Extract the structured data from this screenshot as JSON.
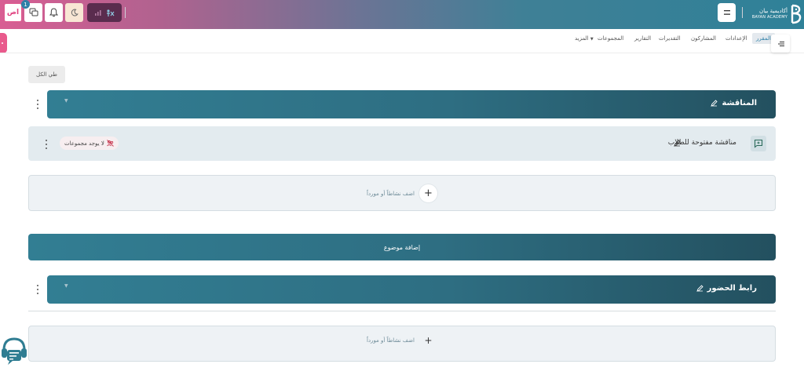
{
  "header": {
    "lang_label": "اص",
    "message_count": "1",
    "brand_name_ar": "أكاديمية بيان",
    "brand_name_en": "BAYAN ACADEMY"
  },
  "nav": {
    "tabs": [
      {
        "label": "المقرر",
        "active": true
      },
      {
        "label": "الإعدادات",
        "active": false
      },
      {
        "label": "المشاركون",
        "active": false
      },
      {
        "label": "التقديرات",
        "active": false
      },
      {
        "label": "التقارير",
        "active": false
      },
      {
        "label": "المجموعات",
        "active": false
      },
      {
        "label": "المزيد",
        "active": false
      }
    ]
  },
  "content": {
    "collapse_all_label": "طي الكل",
    "sections": [
      {
        "title": "المناقشة"
      },
      {
        "title": "رابط الحضور"
      }
    ],
    "activity": {
      "title": "مناقشة مفتوحة للطلاب",
      "groups_badge": "لا يوجد مجموعات"
    },
    "add_activity_label": "اضف نشاطاً أو مورداً",
    "add_topic_label": "إضافة موضوع"
  },
  "colors": {
    "accent": "#2f7d92",
    "pink": "#e95a8c",
    "dark_teal": "#23505f"
  },
  "icons": {
    "brand": "bayan-logo-icon",
    "menu": "hamburger-icon",
    "messages": "chat-icon",
    "notifications": "bell-icon",
    "theme": "moon-icon",
    "accessibility": "accessibility-icon",
    "edit": "pencil-icon",
    "activity": "forum-icon",
    "no_groups": "groups-off-icon",
    "add": "plus-icon",
    "support": "headset-icon"
  }
}
